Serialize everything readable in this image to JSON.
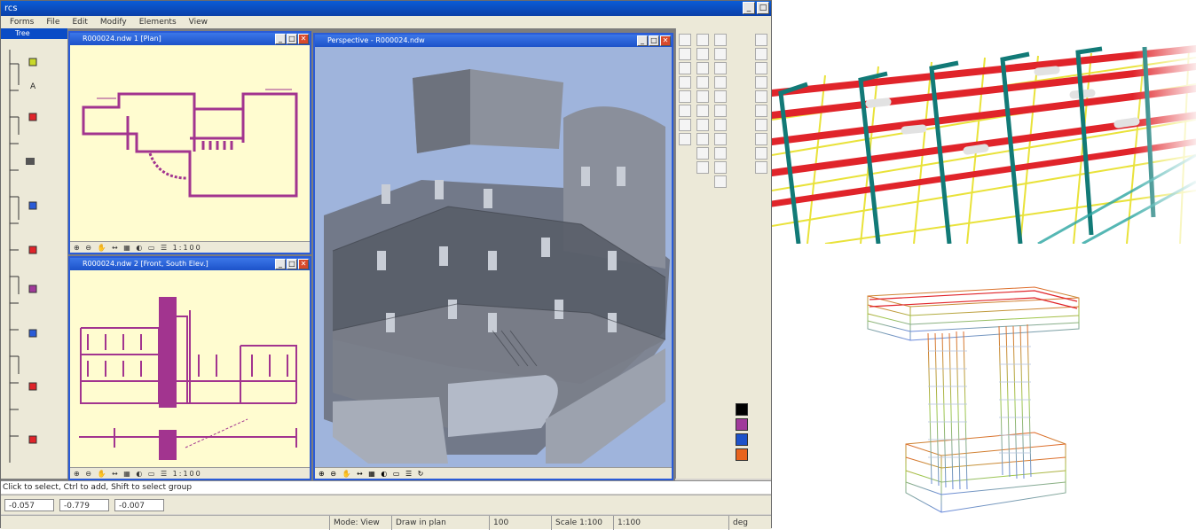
{
  "app": {
    "title": "rcs",
    "window_buttons": [
      "_",
      "□",
      "✕"
    ]
  },
  "menu": {
    "items": [
      "Forms",
      "File",
      "Edit",
      "Modify",
      "Elements",
      "View"
    ]
  },
  "panel": {
    "title": "Tree"
  },
  "plan_window": {
    "title": "R000024.ndw 1 [Plan]",
    "status": "⊕ ⊖ ✋ ↔ ▦ ◐ ▭ ☰ 1:100"
  },
  "elev_window": {
    "title": "R000024.ndw 2 [Front, South Elev.]",
    "status": "⊕ ⊖ ✋ ↔ ▦ ◐ ▭ ☰ 1:100"
  },
  "view3d_window": {
    "title": "Perspective - R000024.ndw",
    "status": "⊕ ⊖ ✋ ↔ ▦ ◐ ▭ ☰ ↻"
  },
  "command_line": "Click to select, Ctrl to add, Shift to select group",
  "coords": {
    "x": "-0.057",
    "y": "-0.779",
    "z": "-0.007"
  },
  "status": {
    "mode": "Mode: View",
    "hint": "Draw in plan",
    "zoom": "100",
    "scale": "Scale 1:100",
    "grid": "1:100",
    "deg": "deg"
  },
  "colors": {
    "accent_title": "#0a4cc6",
    "drawing_magenta": "#a2348f",
    "drawing_bg": "#fffcd0",
    "rebar_red": "#e0242a",
    "rebar_yellow": "#f1ea3a",
    "rebar_teal": "#127a77"
  },
  "swatches": [
    "#000000",
    "#a03a9a",
    "#1d52c9",
    "#e8641e"
  ]
}
